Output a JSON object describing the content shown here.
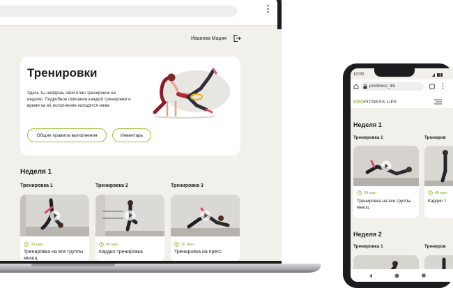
{
  "laptop": {
    "user": {
      "name": "Иванова Мария",
      "logout_icon": "logout-icon"
    },
    "hero": {
      "title": "Тренировки",
      "description": "Здесь ты найдёшь свой план тренировок на неделю. Подробное описание каждой тренировки и время на её исполнение находятся ниже.",
      "buttons": [
        "Общие правила выполнения",
        "Инвентарь"
      ]
    },
    "week": {
      "title": "Неделя 1",
      "workouts": [
        {
          "label": "Тренировка 1",
          "duration": "30 мин",
          "title": "Тренировка на все группы мышц"
        },
        {
          "label": "Тренировка 2",
          "duration": "45 мин",
          "title": "Кардио тренировка"
        },
        {
          "label": "Тренировка 3",
          "duration": "30 мин",
          "title": "Тренировка на пресс"
        }
      ]
    }
  },
  "phone": {
    "status_time": "10:00",
    "url": "profitness_life",
    "brand": {
      "accent": "PRO",
      "rest": "FITNESS LIFE"
    },
    "weeks": [
      {
        "title": "Неделя 1",
        "workouts": [
          {
            "label": "Тренировка 1",
            "duration": "30 мин",
            "title": "Тренировка на все группы мышц"
          },
          {
            "label": "Трениров",
            "duration": "45 мин",
            "title": "Кардио т"
          }
        ]
      },
      {
        "title": "Неделя 2",
        "workouts": [
          {
            "label": "Тренировка 1"
          },
          {
            "label": "Трениров"
          }
        ]
      }
    ]
  },
  "colors": {
    "accent": "#9bc23a",
    "page_bg": "#f1f0eb",
    "device": "#1b1c1e"
  }
}
